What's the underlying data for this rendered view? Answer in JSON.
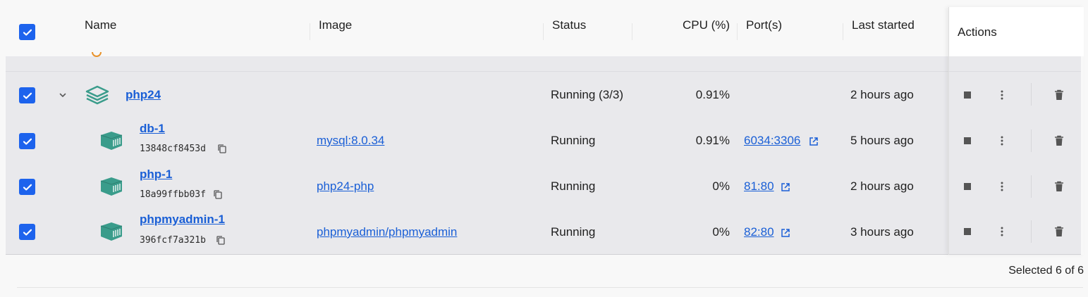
{
  "header": {
    "columns": {
      "name": "Name",
      "image": "Image",
      "status": "Status",
      "cpu": "CPU (%)",
      "ports": "Port(s)",
      "last_started": "Last started",
      "actions": "Actions"
    }
  },
  "group": {
    "name": "php24",
    "status": "Running (3/3)",
    "cpu": "0.91%",
    "last_started": "2 hours ago"
  },
  "containers": [
    {
      "name": "db-1",
      "id": "13848cf8453d",
      "image": "mysql:8.0.34",
      "status": "Running",
      "cpu": "0.91%",
      "port": "6034:3306",
      "last_started": "5 hours ago"
    },
    {
      "name": "php-1",
      "id": "18a99ffbb03f",
      "image": "php24-php",
      "status": "Running",
      "cpu": "0%",
      "port": "81:80",
      "last_started": "2 hours ago"
    },
    {
      "name": "phpmyadmin-1",
      "id": "396fcf7a321b",
      "image": "phpmyadmin/phpmyadmin",
      "status": "Running",
      "cpu": "0%",
      "port": "82:80",
      "last_started": "3 hours ago"
    }
  ],
  "footer": {
    "selection": "Selected 6 of 6"
  },
  "colors": {
    "accent": "#1d63ed",
    "link": "#1a5fd6",
    "container_icon": "#3a9c8b"
  },
  "icons": {
    "checkbox": "check-icon",
    "expand": "chevron-down-icon",
    "group": "stack-icon",
    "container": "container-icon",
    "copy": "copy-icon",
    "external": "external-link-icon",
    "stop": "stop-icon",
    "more": "more-vertical-icon",
    "delete": "trash-icon"
  }
}
